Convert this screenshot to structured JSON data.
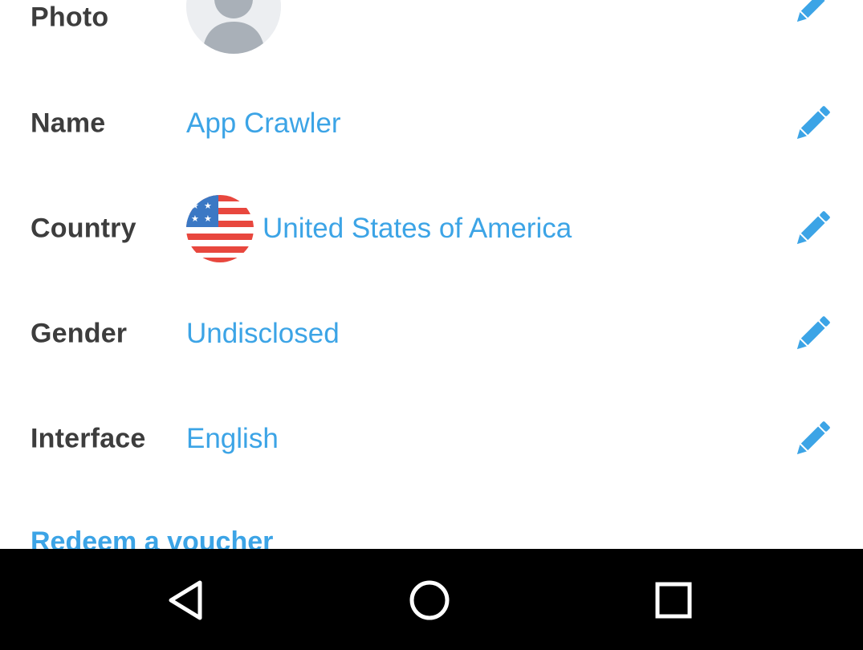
{
  "profile": {
    "rows": [
      {
        "label": "Photo",
        "value": "",
        "edit_icon": "pencil-icon"
      },
      {
        "label": "Name",
        "value": "App Crawler",
        "edit_icon": "pencil-icon"
      },
      {
        "label": "Country",
        "value": "United States of America",
        "flag_icon": "us-flag-icon",
        "edit_icon": "pencil-icon"
      },
      {
        "label": "Gender",
        "value": "Undisclosed",
        "edit_icon": "pencil-icon"
      },
      {
        "label": "Interface",
        "value": "English",
        "edit_icon": "pencil-icon"
      }
    ],
    "avatar_icon": "default-avatar-icon",
    "voucher_link": "Redeem a voucher"
  },
  "navbar": {
    "back_icon": "back-triangle-icon",
    "home_icon": "home-circle-icon",
    "recent_icon": "recent-apps-square-icon"
  },
  "colors": {
    "accent": "#3ca4e6",
    "label": "#3d3d3d",
    "background": "#ffffff",
    "navbar": "#000000",
    "flag_red": "#e8473e",
    "flag_blue": "#3b78c4"
  }
}
